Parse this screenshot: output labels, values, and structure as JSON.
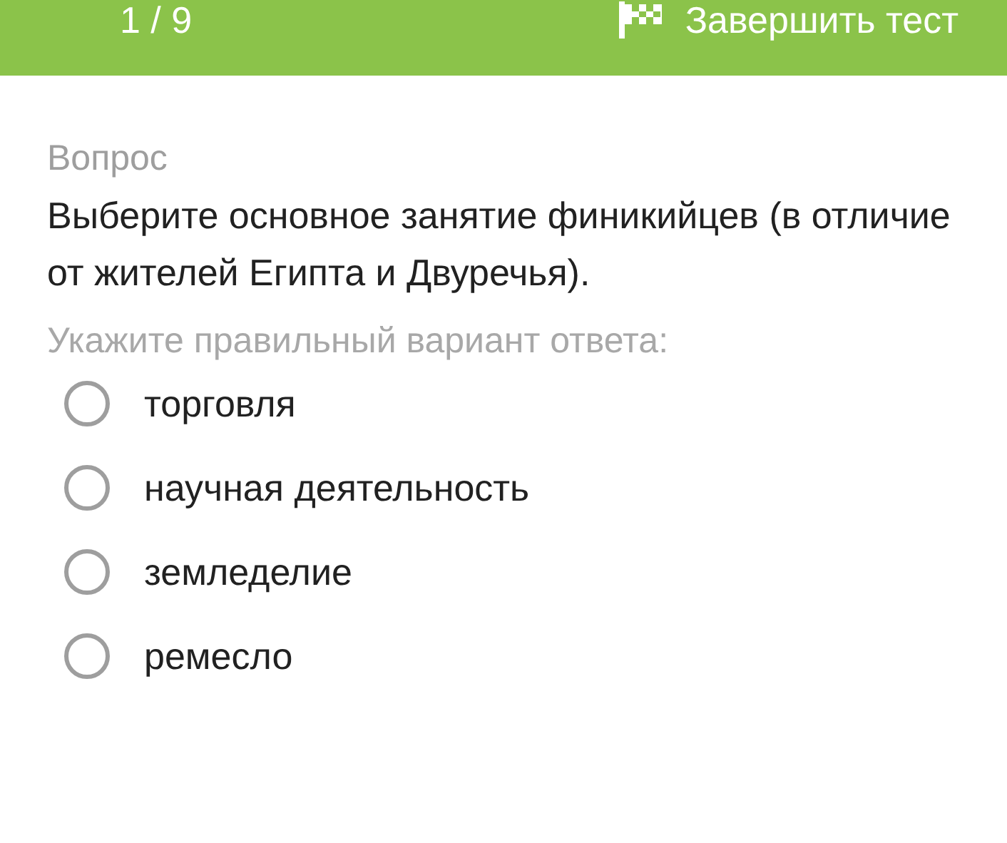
{
  "header": {
    "counter": "1 / 9",
    "finish_button": "Завершить тест"
  },
  "question": {
    "label": "Вопрос",
    "text": "Выберите основное занятие финикийцев (в отличие от жителей Египта и Двуречья).",
    "instruction": "Укажите правильный вариант ответа:"
  },
  "options": [
    {
      "label": "торговля",
      "selected": false
    },
    {
      "label": "научная деятельность",
      "selected": false
    },
    {
      "label": "земледелие",
      "selected": false
    },
    {
      "label": "ремесло",
      "selected": false
    }
  ]
}
